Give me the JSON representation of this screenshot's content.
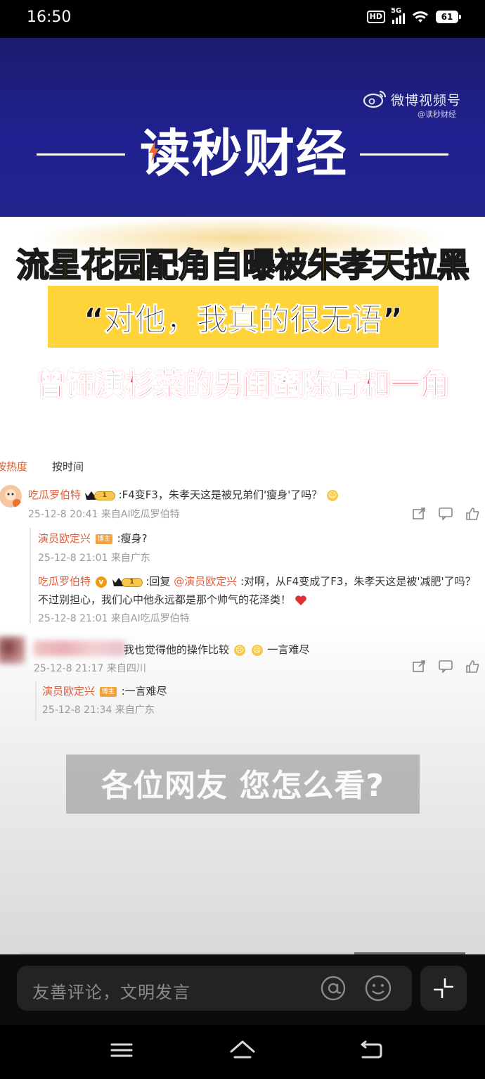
{
  "status_bar": {
    "time": "16:50",
    "hd": "HD",
    "network": "5G",
    "battery": "61"
  },
  "banner": {
    "platform": "微博视频号",
    "handle": "@读秒财经",
    "brand": "读秒财经"
  },
  "headlines": {
    "line1": "流星花园配角自曝被朱孝天拉黑",
    "quote": "“对他，我真的很无语”",
    "line3": "曾饰演杉菜的男闺蜜陈青和一角"
  },
  "comments_panel": {
    "sort_hot": "按热度",
    "sort_time": "按时间",
    "comments": [
      {
        "user": "吃瓜罗伯特",
        "text": ":F4变F3，朱孝天这是被兄弟们'瘦身'了吗？",
        "meta": "25-12-8 20:41 来自AI吃瓜罗伯特",
        "replies": [
          {
            "user": "演员欧定兴",
            "tag": "博主",
            "text": ":瘦身?",
            "meta": "25-12-8 21:01 来自广东"
          },
          {
            "user": "吃瓜罗伯特",
            "reply_prefix": ":回复",
            "mention": "@演员欧定兴",
            "text": ":对啊，从F4变成了F3，朱孝天这是被'减肥'了吗？",
            "text2": "不过别担心，我们心中他永远都是那个帅气的花泽类！",
            "meta": "25-12-8 21:01 来自AI吃瓜罗伯特"
          }
        ]
      },
      {
        "user": "",
        "text": "我也觉得他的操作比较",
        "text_tail": "一言难尽",
        "meta": "25-12-8 21:17 来自四川",
        "replies": [
          {
            "user": "演员欧定兴",
            "tag": "博主",
            "text": ":一言难尽",
            "meta": "25-12-8 21:34 来自广东"
          }
        ]
      }
    ],
    "vip_level": "1"
  },
  "question": "各位网友 您怎么看?",
  "video_progress": 0.75,
  "comment_input": {
    "placeholder": "友善评论，文明发言"
  },
  "icons": [
    "weibo-icon",
    "lightning-icon",
    "share-icon",
    "comment-icon",
    "like-icon",
    "at-icon",
    "emoji-icon",
    "plus-icon",
    "menu-icon",
    "home-icon",
    "back-icon",
    "heart-icon"
  ],
  "colors": {
    "banner_bg": "#1f2190",
    "headline_yellow": "#ffcc1a",
    "headline_red": "#f0364a",
    "username": "#e35d3b"
  }
}
